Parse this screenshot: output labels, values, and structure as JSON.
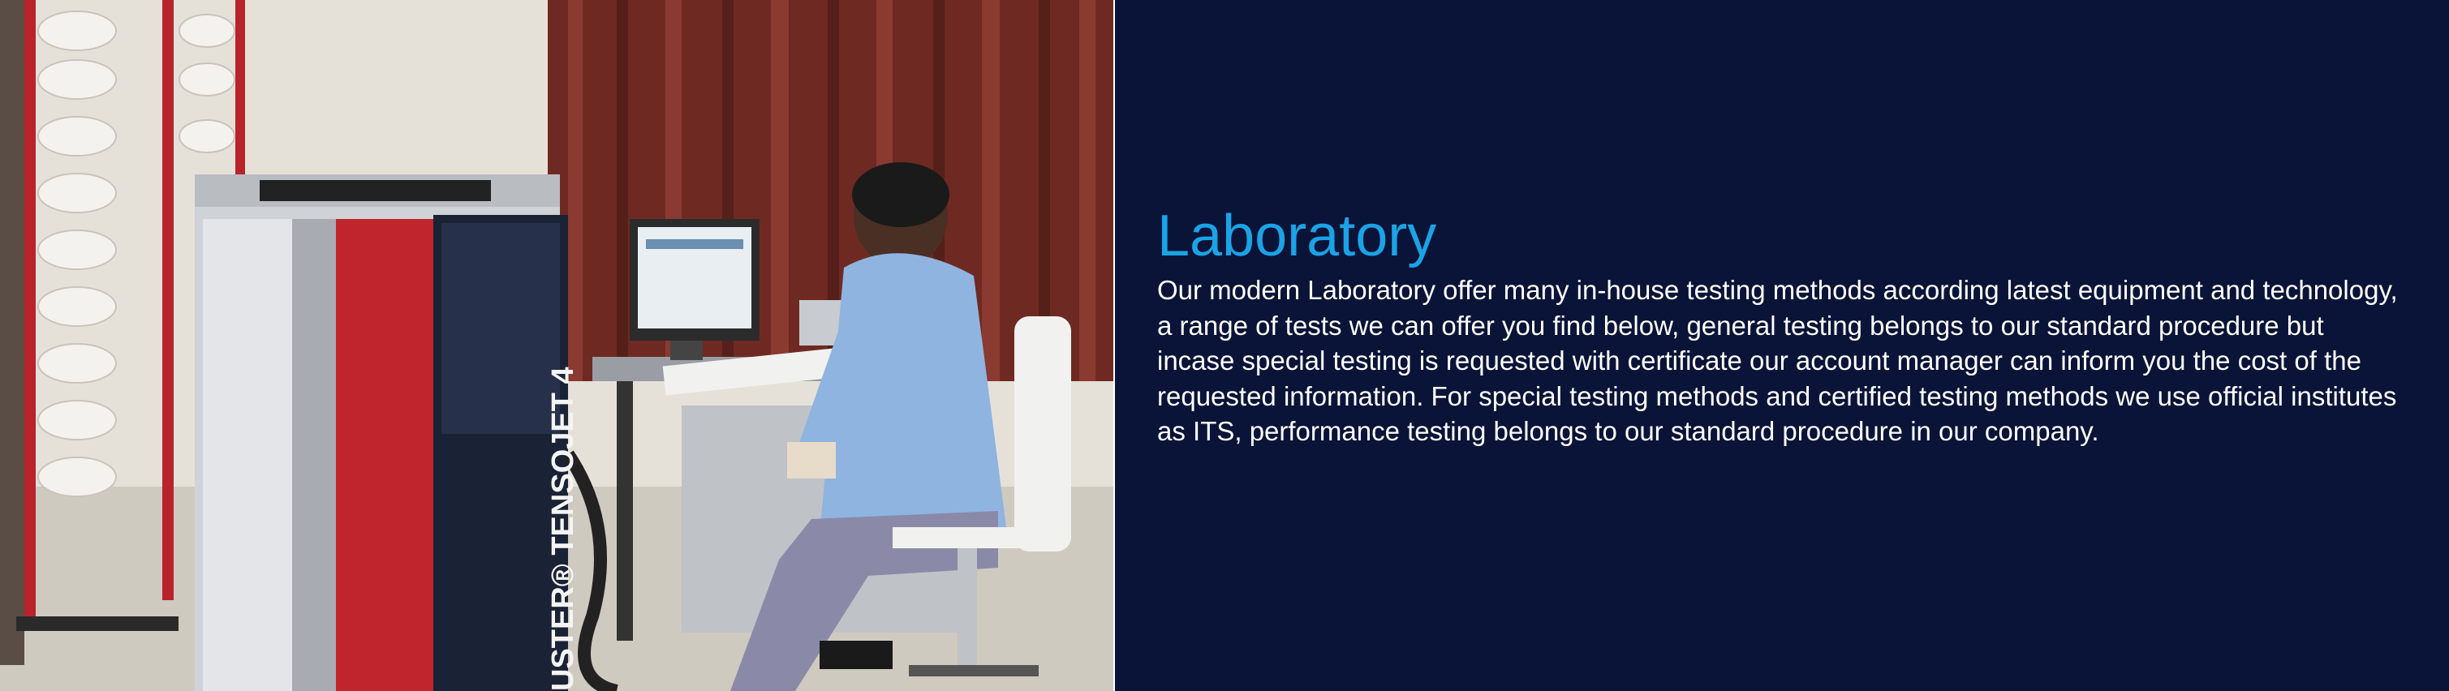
{
  "photo": {
    "machine_label": "USTER® TENSOJET 4"
  },
  "section": {
    "title": "Laboratory",
    "description": "Our modern Laboratory offer many in-house testing methods according latest equipment and technology, a range of tests we can offer you find below, general testing belongs to our standard procedure but incase special testing is requested with certificate our account manager can inform you the cost of the requested information. For special testing methods and certified testing methods we use official institutes as ITS, performance testing belongs to our standard procedure in our company."
  },
  "colors": {
    "background": "#0a1438",
    "title": "#1aa3e6",
    "text": "#ffffff"
  }
}
